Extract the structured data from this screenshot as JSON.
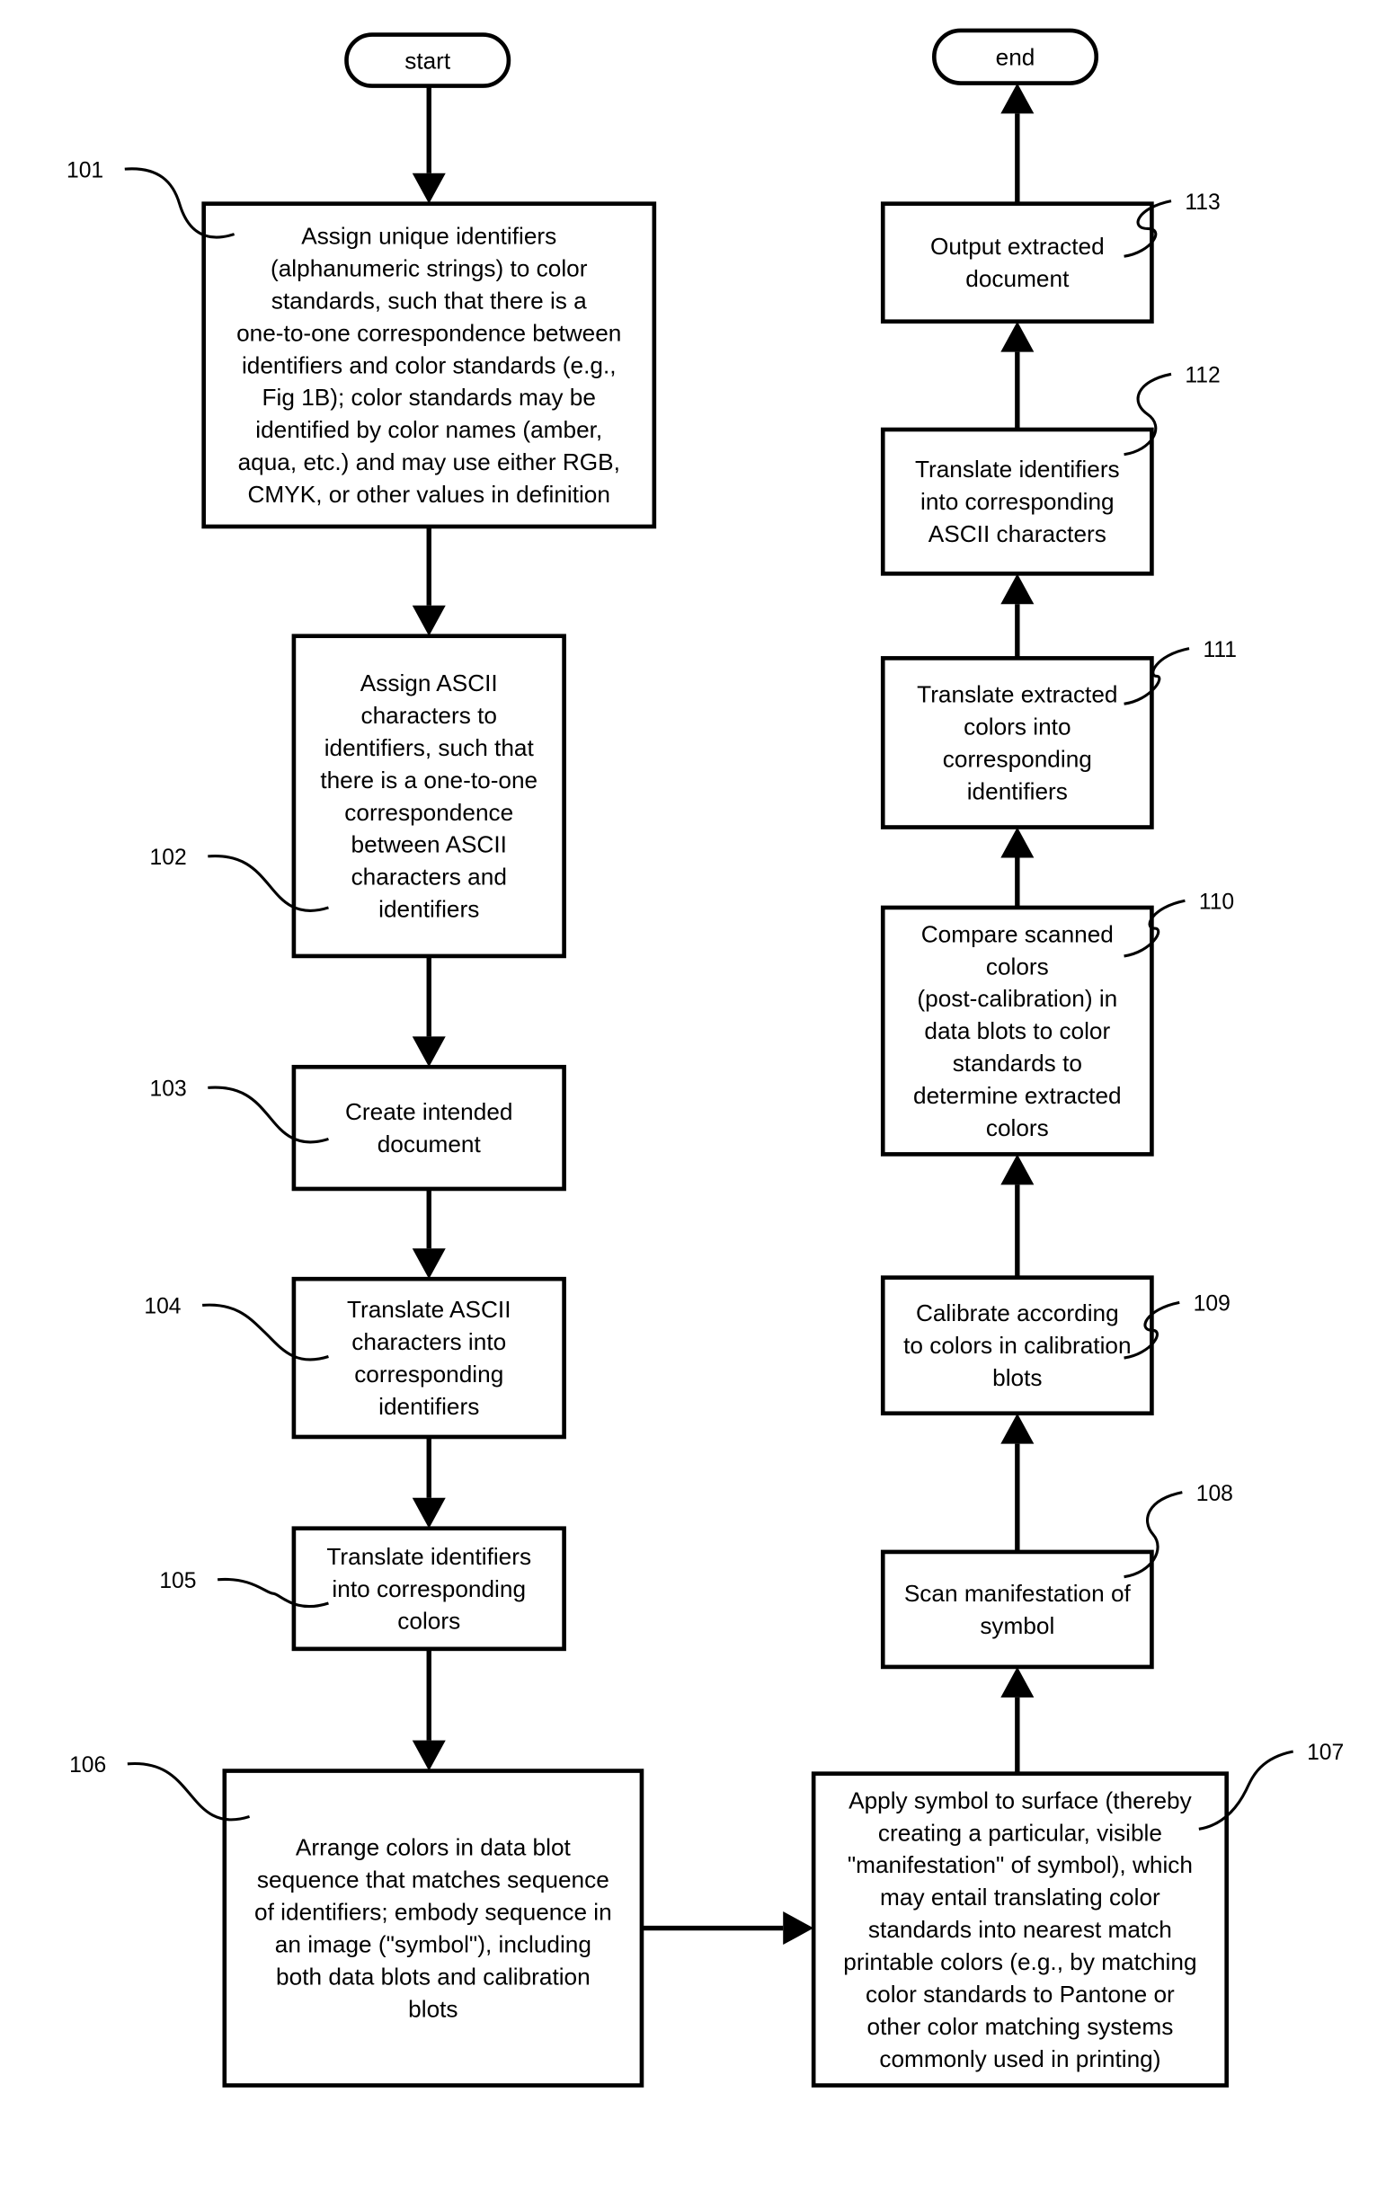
{
  "diagram": {
    "type": "flowchart",
    "terminals": {
      "start": {
        "label": "start"
      },
      "end": {
        "label": "end"
      }
    },
    "nodes": [
      {
        "id": "101",
        "ref": "101",
        "lines": [
          "Assign unique identifiers",
          "(alphanumeric strings) to color",
          "standards, such that there is a",
          "one-to-one correspondence between",
          "identifiers and color standards (e.g.,",
          "Fig 1B); color standards may  be",
          "identified by color names (amber,",
          "aqua, etc.) and may use either RGB,",
          "CMYK, or other values in definition"
        ]
      },
      {
        "id": "102",
        "ref": "102",
        "lines": [
          "Assign ASCII",
          "characters to",
          "identifiers, such that",
          "there is a one-to-one",
          "correspondence",
          "between ASCII",
          "characters and",
          "identifiers"
        ]
      },
      {
        "id": "103",
        "ref": "103",
        "lines": [
          "Create intended",
          "document"
        ]
      },
      {
        "id": "104",
        "ref": "104",
        "lines": [
          "Translate ASCII",
          "characters into",
          "corresponding",
          "identifiers"
        ]
      },
      {
        "id": "105",
        "ref": "105",
        "lines": [
          "Translate identifiers",
          "into corresponding",
          "colors"
        ]
      },
      {
        "id": "106",
        "ref": "106",
        "lines": [
          "Arrange colors in data blot",
          "sequence that matches sequence",
          "of identifiers; embody sequence in",
          "an image (\"symbol\"), including",
          "both data blots and calibration",
          "blots"
        ]
      },
      {
        "id": "107",
        "ref": "107",
        "lines": [
          "Apply symbol to surface (thereby",
          "creating a particular, visible",
          "\"manifestation\" of symbol), which",
          "may entail translating color",
          "standards into nearest match",
          "printable colors (e.g., by matching",
          "color standards to Pantone or",
          "other color matching systems",
          "commonly used in printing)"
        ]
      },
      {
        "id": "108",
        "ref": "108",
        "lines": [
          "Scan manifestation of",
          "symbol"
        ]
      },
      {
        "id": "109",
        "ref": "109",
        "lines": [
          "Calibrate according",
          "to colors in calibration",
          "blots"
        ]
      },
      {
        "id": "110",
        "ref": "110",
        "lines": [
          "Compare scanned",
          "colors",
          "(post-calibration)  in",
          "data blots to color",
          "standards to",
          "determine extracted",
          "colors"
        ]
      },
      {
        "id": "111",
        "ref": "111",
        "lines": [
          "Translate extracted",
          "colors into",
          "corresponding",
          "identifiers"
        ]
      },
      {
        "id": "112",
        "ref": "112",
        "lines": [
          "Translate identifiers",
          "into corresponding",
          "ASCII characters"
        ]
      },
      {
        "id": "113",
        "ref": "113",
        "lines": [
          "Output extracted",
          "document"
        ]
      }
    ],
    "edges": [
      [
        "start",
        "101"
      ],
      [
        "101",
        "102"
      ],
      [
        "102",
        "103"
      ],
      [
        "103",
        "104"
      ],
      [
        "104",
        "105"
      ],
      [
        "105",
        "106"
      ],
      [
        "106",
        "107"
      ],
      [
        "107",
        "108"
      ],
      [
        "108",
        "109"
      ],
      [
        "109",
        "110"
      ],
      [
        "110",
        "111"
      ],
      [
        "111",
        "112"
      ],
      [
        "112",
        "113"
      ],
      [
        "113",
        "end"
      ]
    ]
  }
}
